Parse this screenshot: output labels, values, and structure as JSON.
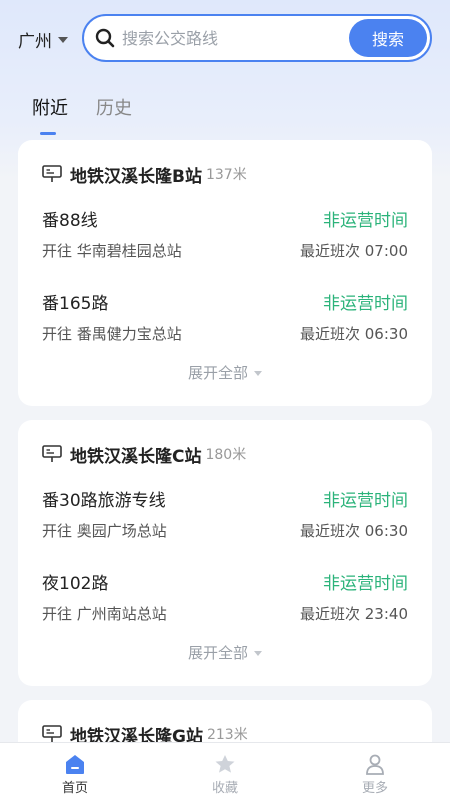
{
  "header": {
    "city": "广州",
    "search_placeholder": "搜索公交路线",
    "search_button": "搜索"
  },
  "tabs": [
    {
      "label": "附近",
      "active": true
    },
    {
      "label": "历史",
      "active": false
    }
  ],
  "cards": [
    {
      "station": "地铁汉溪长隆B站",
      "distance": "137米",
      "routes": [
        {
          "name": "番88线",
          "status": "非运营时间",
          "direction": "开往 华南碧桂园总站",
          "next": "最近班次 07:00"
        },
        {
          "name": "番165路",
          "status": "非运营时间",
          "direction": "开往 番禺健力宝总站",
          "next": "最近班次 06:30"
        }
      ],
      "expand": "展开全部"
    },
    {
      "station": "地铁汉溪长隆C站",
      "distance": "180米",
      "routes": [
        {
          "name": "番30路旅游专线",
          "status": "非运营时间",
          "direction": "开往 奥园广场总站",
          "next": "最近班次 06:30"
        },
        {
          "name": "夜102路",
          "status": "非运营时间",
          "direction": "开往 广州南站总站",
          "next": "最近班次 23:40"
        }
      ],
      "expand": "展开全部"
    },
    {
      "station": "地铁汉溪长隆G站",
      "distance": "213米"
    }
  ],
  "nav": [
    {
      "label": "首页",
      "icon": "home-icon",
      "active": true
    },
    {
      "label": "收藏",
      "icon": "star-icon",
      "active": false
    },
    {
      "label": "更多",
      "icon": "user-icon",
      "active": false
    }
  ],
  "colors": {
    "accent": "#4b82f0",
    "status_green": "#2bb37a"
  }
}
